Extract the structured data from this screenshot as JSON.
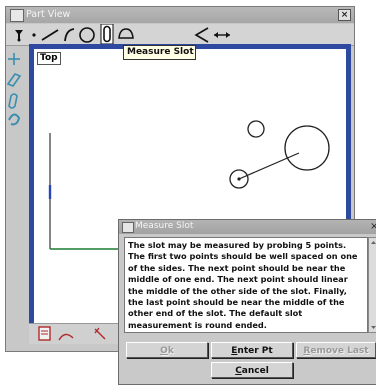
{
  "part_view": {
    "title": "Part View",
    "close_label": "×",
    "tooltip": "Measure Slot",
    "view_label": "Top",
    "toolbar": [
      {
        "name": "probe-icon"
      },
      {
        "name": "point-icon"
      },
      {
        "name": "line-icon"
      },
      {
        "name": "arc-icon"
      },
      {
        "name": "circle-icon"
      },
      {
        "name": "slot-icon"
      },
      {
        "name": "ellipse-icon"
      },
      {
        "name": "cone-icon"
      },
      {
        "name": "distance-icon"
      }
    ]
  },
  "measure_slot": {
    "title": "Measure Slot",
    "close_label": "×",
    "instructions": "The slot may be measured by probing 5 points.  The first two points should be well spaced on one of the sides.  The next point should be near the middle of one end.  The next point should linear the middle of the other side of the slot. Finally, the last point should be near the middle of the other end of the slot. The default slot measurement is round ended.",
    "buttons": {
      "ok": {
        "prefix": "",
        "key": "O",
        "rest": "k"
      },
      "enter_pt": {
        "prefix": "",
        "key": "E",
        "rest": "nter Pt"
      },
      "remove_last": {
        "prefix": "",
        "key": "R",
        "rest": "emove Last"
      },
      "cancel": {
        "prefix": "",
        "key": "C",
        "rest": "ancel"
      }
    }
  }
}
